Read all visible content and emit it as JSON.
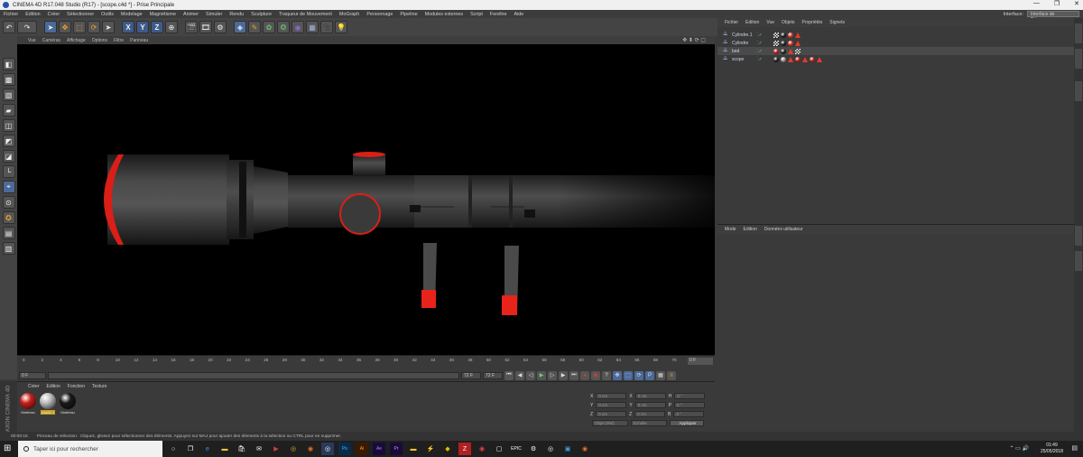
{
  "window": {
    "title": "CINEMA 4D R17.048 Studio (R17) - [scope.c4d *] - Prise Principale",
    "controls": [
      "—",
      "❐",
      "✕"
    ]
  },
  "menubar": [
    "Fichier",
    "Edition",
    "Créer",
    "Sélectionner",
    "Outils",
    "Modelage",
    "Magnétisme",
    "Animer",
    "Simuler",
    "Rendu",
    "Sculpture",
    "Traqueur de Mouvement",
    "MoGraph",
    "Personnage",
    "Pipeline",
    "Modules externes",
    "Script",
    "Fenêtre",
    "Aide"
  ],
  "interface": {
    "label": "Interface:",
    "value": "Interface de Démarrage"
  },
  "viewport_menu": [
    "Vue",
    "Caméras",
    "Affichage",
    "Options",
    "Filtre",
    "Panneau"
  ],
  "object_manager": {
    "menu": [
      "Fichier",
      "Edition",
      "Vue",
      "Objets",
      "Propriétés",
      "Signets"
    ],
    "objects": [
      {
        "name": "Cylindre.1"
      },
      {
        "name": "Cylindre"
      },
      {
        "name": "bed"
      },
      {
        "name": "scope"
      }
    ]
  },
  "attribute_manager": {
    "menu": [
      "Mode",
      "Edition",
      "Données utilisateur"
    ]
  },
  "timeline": {
    "ticks": [
      "0",
      "2",
      "4",
      "6",
      "8",
      "10",
      "12",
      "14",
      "16",
      "18",
      "20",
      "22",
      "24",
      "26",
      "28",
      "30",
      "32",
      "34",
      "36",
      "38",
      "40",
      "42",
      "44",
      "46",
      "48",
      "50",
      "52",
      "54",
      "56",
      "58",
      "60",
      "62",
      "64",
      "66",
      "68",
      "70",
      "72"
    ],
    "frame_field": "0 F",
    "start": "0 F",
    "end": "72 F",
    "end2": "72 F"
  },
  "material_panel": {
    "menu": [
      "Créer",
      "Edition",
      "Fonction",
      "Texture"
    ],
    "materials": [
      {
        "name": "Matériau",
        "color": "#c8201a"
      },
      {
        "name": "plastic.1",
        "color": "#bdbdbd"
      },
      {
        "name": "Matériau",
        "color": "#1a1a1a"
      }
    ]
  },
  "coords": {
    "rows": [
      [
        "X",
        "0 cm",
        "X",
        "0 cm",
        "H",
        "0 °"
      ],
      [
        "Y",
        "0 cm",
        "Y",
        "0 cm",
        "P",
        "0 °"
      ],
      [
        "Z",
        "0 cm",
        "Z",
        "0 cm",
        "B",
        "0 °"
      ]
    ],
    "dropdown1": "Objet (Rel)",
    "dropdown2": "Echelle",
    "apply": "Appliquer"
  },
  "status": {
    "time": "00:00:16",
    "text": "Pinceau de sélection : Cliquez, glissez pour sélectionner des éléments. Appuyez sur MAJ pour ajouter des éléments à la sélection ou CTRL pour en supprimer."
  },
  "maxon": "MAXON CINEMA 4D",
  "taskbar": {
    "search_placeholder": "Taper ici pour rechercher",
    "time": "01:49",
    "date": "25/05/2018"
  },
  "colors": {
    "accent_red": "#e8231a",
    "object_blue": "#8fa8d8"
  }
}
